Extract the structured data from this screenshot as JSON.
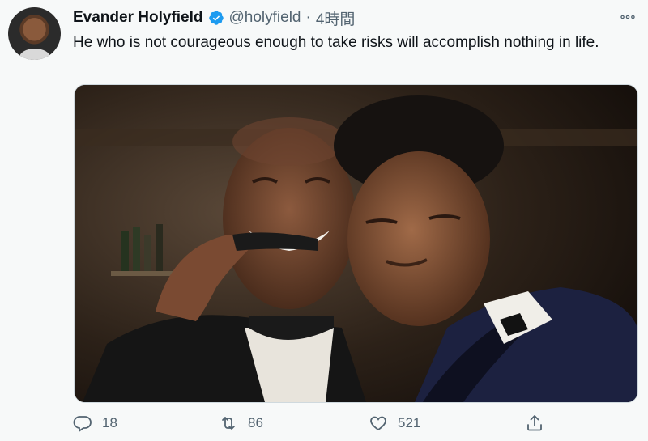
{
  "tweet": {
    "author": {
      "name": "Evander Holyfield",
      "handle": "@holyfield",
      "separator": "·",
      "time": "4時間"
    },
    "text": "He who is not courageous enough to take risks will accomplish nothing in life.",
    "actions": {
      "reply_count": "18",
      "retweet_count": "86",
      "like_count": "521"
    }
  },
  "icons": {
    "verified": "verified-badge-icon",
    "more": "more-icon",
    "reply": "reply-icon",
    "retweet": "retweet-icon",
    "like": "heart-icon",
    "share": "share-icon"
  },
  "colors": {
    "verified": "#1d9bf0",
    "secondary_text": "#536471",
    "primary_text": "#0f1419"
  }
}
